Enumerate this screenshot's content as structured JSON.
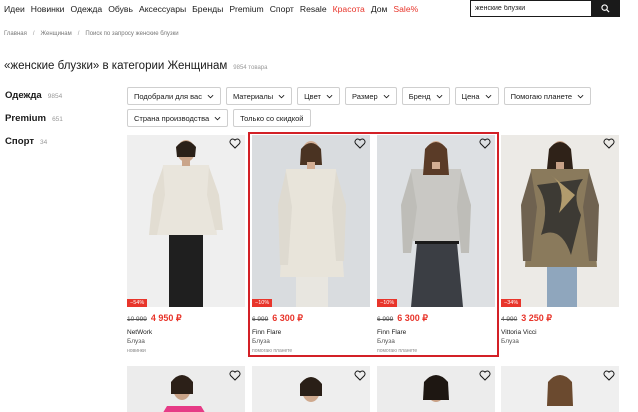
{
  "nav": {
    "items": [
      "Идеи",
      "Новинки",
      "Одежда",
      "Обувь",
      "Аксессуары",
      "Бренды",
      "Premium",
      "Спорт",
      "Resale"
    ],
    "red_items": [
      "Красота",
      "Дом",
      "Sale%"
    ]
  },
  "search": {
    "value": "женские блузки"
  },
  "breadcrumb": [
    "Главная",
    "Женщинам",
    "Поиск по запросу женские блузки"
  ],
  "page": {
    "title": "«женские блузки» в категории Женщинам",
    "count": "9854 товара"
  },
  "sidebar": [
    {
      "label": "Одежда",
      "count": "9854"
    },
    {
      "label": "Premium",
      "count": "651"
    },
    {
      "label": "Спорт",
      "count": "34"
    }
  ],
  "filters": {
    "row1": [
      "Подобрали для вас",
      "Материалы",
      "Цвет",
      "Размер",
      "Бренд",
      "Цена",
      "Помогаю планете"
    ],
    "row2": [
      "Страна производства"
    ],
    "plain": "Только со скидкой"
  },
  "products": [
    {
      "discount": "−54%",
      "old_price": "10 999",
      "price": "4 950 ₽",
      "brand": "NetWork",
      "type": "Блуза",
      "tag": "новинки"
    },
    {
      "discount": "−10%",
      "old_price": "6 999",
      "price": "6 300 ₽",
      "brand": "Finn Flare",
      "type": "Блуза",
      "tag": "помогаю планете"
    },
    {
      "discount": "−10%",
      "old_price": "6 999",
      "price": "6 300 ₽",
      "brand": "Finn Flare",
      "type": "Блуза",
      "tag": "помогаю планете"
    },
    {
      "discount": "−34%",
      "old_price": "4 990",
      "price": "3 250 ₽",
      "brand": "Vittoria Vicci",
      "type": "Блуза",
      "tag": ""
    }
  ],
  "colors": {
    "accent": "#e8352b",
    "highlight": "#d32026",
    "text": "#1a1a1a"
  },
  "icons": {
    "search": "search-icon",
    "favorite": "heart-icon",
    "dropdown": "chevron-down-icon"
  }
}
